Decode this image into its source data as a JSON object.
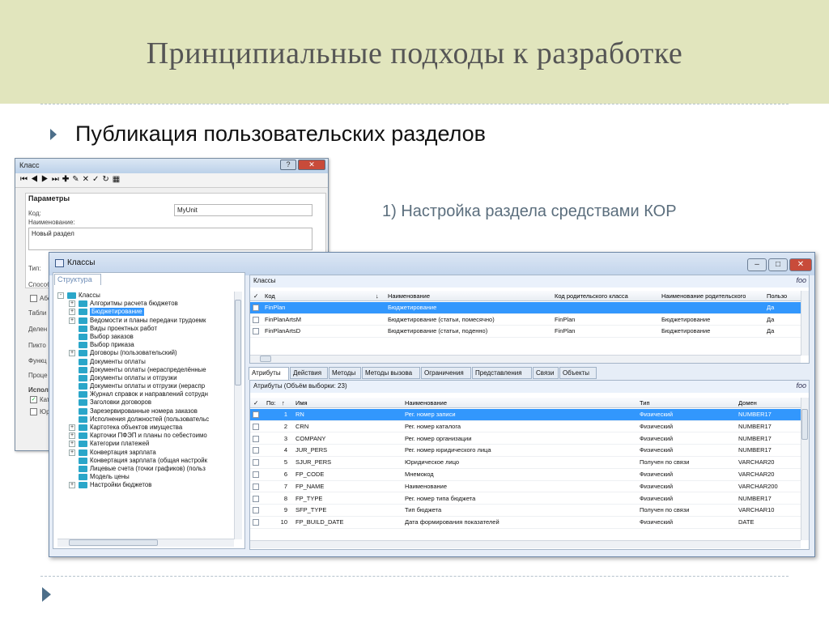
{
  "slide": {
    "title": "Принципиальные подходы к разработке",
    "bullet": "Публикация пользовательских разделов",
    "note": "1) Настройка раздела средствами КОР"
  },
  "colors": {
    "header_bg": "#e1e5bd",
    "accent": "#4d6f8a",
    "selection": "#3297fd"
  },
  "back_dialog": {
    "title": "Класс",
    "toolbar_icons": [
      "first-icon",
      "prev-icon",
      "next-icon",
      "last-icon",
      "add-icon",
      "edit-icon",
      "delete-icon",
      "apply-icon",
      "refresh-icon",
      "calculator-icon"
    ],
    "group_label": "Параметры",
    "code_label": "Код:",
    "code_value": "MyUnit",
    "name_label": "Наименование:",
    "name_value": "Новый раздел",
    "cut_labels": [
      "Тип:",
      "Способ",
      "Табли",
      "Делен",
      "Пикто",
      "Функц",
      "Проце"
    ],
    "checkbox_a": "Абс",
    "usage_label": "Испол",
    "usage_check1": "Кат",
    "usage_check2": "Юр"
  },
  "main_window": {
    "title": "Классы",
    "left_tab": "Структура",
    "tree": [
      {
        "label": "Классы",
        "level": 0,
        "expander": "-"
      },
      {
        "label": "Алгоритмы расчета бюджетов",
        "level": 1,
        "expander": "+"
      },
      {
        "label": "Бюджетирование",
        "level": 1,
        "expander": "+",
        "selected": true
      },
      {
        "label": "Ведомости и планы передачи трудоемк",
        "level": 1,
        "expander": "+"
      },
      {
        "label": "Виды проектных работ",
        "level": 1,
        "expander": ""
      },
      {
        "label": "Выбор заказов",
        "level": 1,
        "expander": ""
      },
      {
        "label": "Выбор приказа",
        "level": 1,
        "expander": ""
      },
      {
        "label": "Договоры (пользовательский)",
        "level": 1,
        "expander": "+"
      },
      {
        "label": "Документы оплаты",
        "level": 1,
        "expander": ""
      },
      {
        "label": "Документы оплаты (нераспределённые",
        "level": 1,
        "expander": ""
      },
      {
        "label": "Документы оплаты и отгрузки",
        "level": 1,
        "expander": ""
      },
      {
        "label": "Документы оплаты и отгрузки (нераспр",
        "level": 1,
        "expander": ""
      },
      {
        "label": "Журнал справок и направлений сотрудн",
        "level": 1,
        "expander": ""
      },
      {
        "label": "Заголовки договоров",
        "level": 1,
        "expander": ""
      },
      {
        "label": "Зарезервированные номера заказов",
        "level": 1,
        "expander": ""
      },
      {
        "label": "Исполнения должностей (пользовательс",
        "level": 1,
        "expander": ""
      },
      {
        "label": "Картотека объектов имущества",
        "level": 1,
        "expander": "+"
      },
      {
        "label": "Карточки ПФЭП и планы по себестоимо",
        "level": 1,
        "expander": "+"
      },
      {
        "label": "Категории платежей",
        "level": 1,
        "expander": "+"
      },
      {
        "label": "Конвертация зарплата",
        "level": 1,
        "expander": "+"
      },
      {
        "label": "Конвертация зарплата (общая настройк",
        "level": 1,
        "expander": ""
      },
      {
        "label": "Лицевые счета (точки графиков) (польз",
        "level": 1,
        "expander": ""
      },
      {
        "label": "Модель цены",
        "level": 1,
        "expander": ""
      },
      {
        "label": "Настройки бюджетов",
        "level": 1,
        "expander": "+"
      }
    ],
    "classes_pane": {
      "header": "Классы",
      "fx": "foo",
      "columns": [
        "Код",
        "Наименование",
        "Код родительского класса",
        "Наименование родительского",
        "Пользо"
      ],
      "rows": [
        {
          "code": "FinPlan",
          "name": "Бюджетирование",
          "parent_code": "",
          "parent_name": "",
          "user": "Да",
          "selected": true
        },
        {
          "code": "FinPlanArtsM",
          "name": "Бюджетирование (статьи, помесячно)",
          "parent_code": "FinPlan",
          "parent_name": "Бюджетирование",
          "user": "Да"
        },
        {
          "code": "FinPlanArtsD",
          "name": "Бюджетирование (статьи, поденно)",
          "parent_code": "FinPlan",
          "parent_name": "Бюджетирование",
          "user": "Да"
        }
      ]
    },
    "tabs": [
      "Атрибуты",
      "Действия",
      "Методы",
      "Методы вызова",
      "Ограничения",
      "Представления",
      "Связи",
      "Объекты"
    ],
    "attrs_pane": {
      "header": "Атрибуты (Объём выборки: 23)",
      "fx": "foo",
      "columns": [
        "По:",
        "Имя",
        "Наименование",
        "Тип",
        "Домен"
      ],
      "rows": [
        {
          "n": "1",
          "name": "RN",
          "title": "Рег. номер записи",
          "type": "Физический",
          "domain": "NUMBER17",
          "selected": true
        },
        {
          "n": "2",
          "name": "CRN",
          "title": "Рег. номер каталога",
          "type": "Физический",
          "domain": "NUMBER17"
        },
        {
          "n": "3",
          "name": "COMPANY",
          "title": "Рег. номер организации",
          "type": "Физический",
          "domain": "NUMBER17"
        },
        {
          "n": "4",
          "name": "JUR_PERS",
          "title": "Рег. номер юридического лица",
          "type": "Физический",
          "domain": "NUMBER17"
        },
        {
          "n": "5",
          "name": "SJUR_PERS",
          "title": "Юридическое лицо",
          "type": "Получен по связи",
          "domain": "VARCHAR20"
        },
        {
          "n": "6",
          "name": "FP_CODE",
          "title": "Мнемокод",
          "type": "Физический",
          "domain": "VARCHAR20"
        },
        {
          "n": "7",
          "name": "FP_NAME",
          "title": "Наименование",
          "type": "Физический",
          "domain": "VARCHAR200"
        },
        {
          "n": "8",
          "name": "FP_TYPE",
          "title": "Рег. номер типа бюджета",
          "type": "Физический",
          "domain": "NUMBER17"
        },
        {
          "n": "9",
          "name": "SFP_TYPE",
          "title": "Тип бюджета",
          "type": "Получен по связи",
          "domain": "VARCHAR10"
        },
        {
          "n": "10",
          "name": "FP_BUILD_DATE",
          "title": "Дата формирования показателей",
          "type": "Физический",
          "domain": "DATE"
        }
      ]
    }
  }
}
